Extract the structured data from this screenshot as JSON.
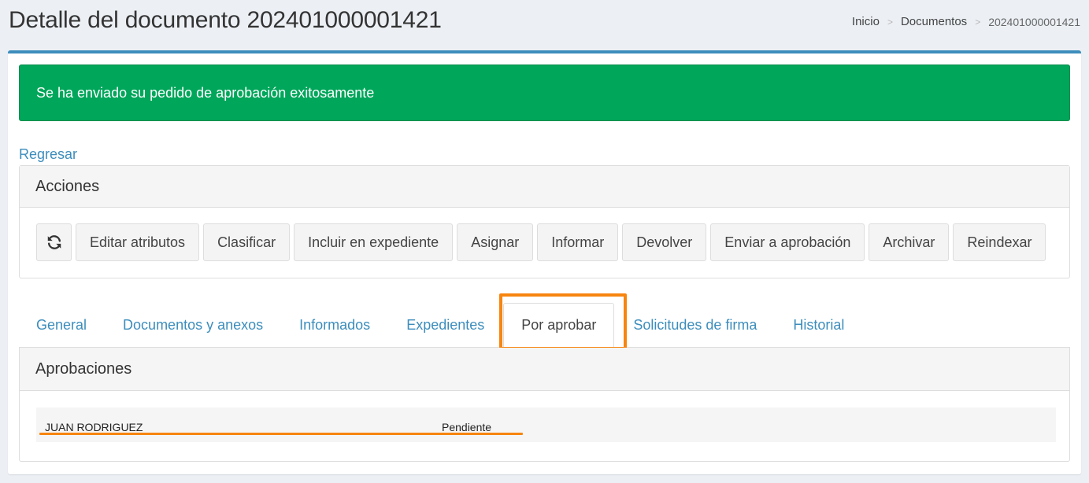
{
  "header": {
    "title": "Detalle del documento 202401000001421",
    "breadcrumb": [
      "Inicio",
      "Documentos",
      "202401000001421"
    ]
  },
  "alert": {
    "message": "Se ha enviado su pedido de aprobación exitosamente",
    "color": "#00a65a"
  },
  "back_link": "Regresar",
  "actions": {
    "title": "Acciones",
    "refresh_icon": "refresh-icon",
    "buttons": [
      "Editar atributos",
      "Clasificar",
      "Incluir en expediente",
      "Asignar",
      "Informar",
      "Devolver",
      "Enviar a aprobación",
      "Archivar",
      "Reindexar"
    ]
  },
  "tabs": [
    "General",
    "Documentos y anexos",
    "Informados",
    "Expedientes",
    "Por aprobar",
    "Solicitudes de firma",
    "Historial"
  ],
  "active_tab": "Por aprobar",
  "approvals": {
    "title": "Aprobaciones",
    "rows": [
      {
        "name": "JUAN RODRIGUEZ",
        "status": "Pendiente"
      }
    ]
  },
  "colors": {
    "accent": "#3c8dbc",
    "annotation": "#f7850f",
    "success": "#00a65a"
  }
}
